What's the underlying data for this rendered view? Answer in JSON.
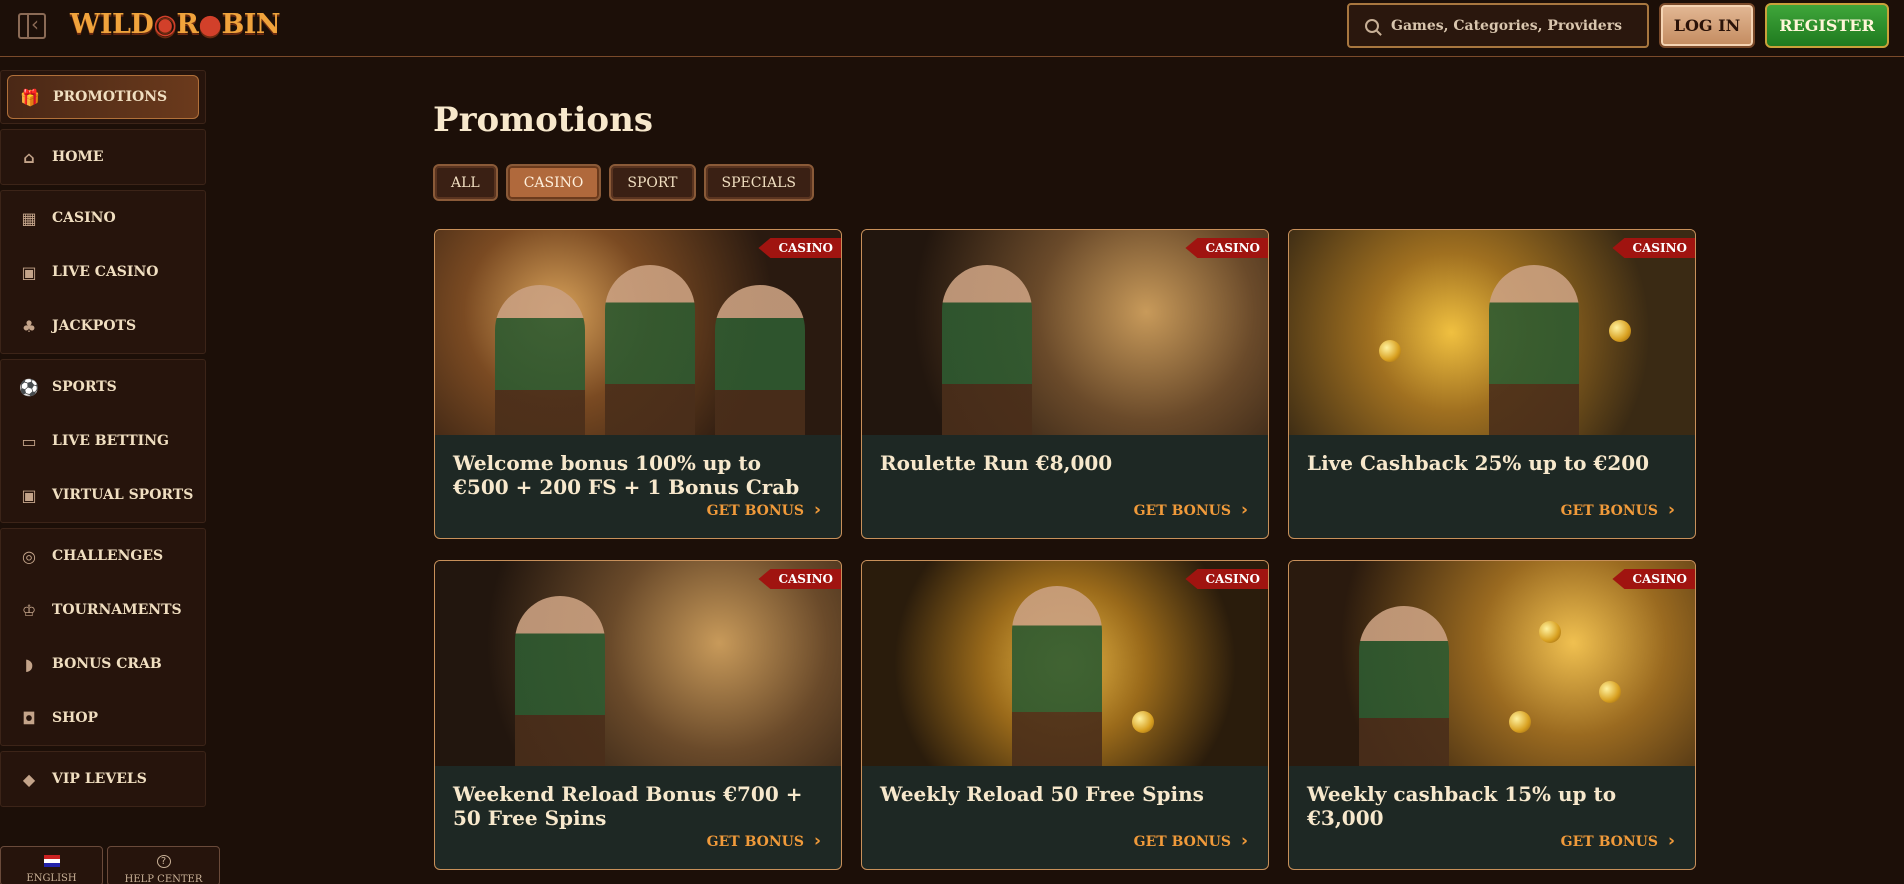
{
  "header": {
    "logo_text_1": "WILD",
    "logo_text_2": "R",
    "logo_text_3": "BIN",
    "search_placeholder": "Games, Categories, Providers",
    "login_label": "LOG IN",
    "register_label": "REGISTER"
  },
  "sidebar": {
    "groups": [
      [
        {
          "label": "PROMOTIONS",
          "icon": "gift-icon",
          "active": true
        }
      ],
      [
        {
          "label": "HOME",
          "icon": "home-icon"
        }
      ],
      [
        {
          "label": "CASINO",
          "icon": "slot-machine-icon"
        },
        {
          "label": "LIVE CASINO",
          "icon": "live-cards-icon"
        },
        {
          "label": "JACKPOTS",
          "icon": "clover-icon"
        }
      ],
      [
        {
          "label": "SPORTS",
          "icon": "football-icon"
        },
        {
          "label": "LIVE BETTING",
          "icon": "live-badge-icon"
        },
        {
          "label": "VIRTUAL SPORTS",
          "icon": "virtual-sports-icon"
        }
      ],
      [
        {
          "label": "CHALLENGES",
          "icon": "target-icon"
        },
        {
          "label": "TOURNAMENTS",
          "icon": "trophy-icon"
        },
        {
          "label": "BONUS CRAB",
          "icon": "crab-icon"
        },
        {
          "label": "SHOP",
          "icon": "shopping-bag-icon"
        }
      ],
      [
        {
          "label": "VIP LEVELS",
          "icon": "diamond-icon"
        }
      ]
    ],
    "language_label": "ENGLISH",
    "help_label": "HELP CENTER"
  },
  "main": {
    "title": "Promotions",
    "filters": [
      {
        "label": "ALL",
        "active": false
      },
      {
        "label": "CASINO",
        "active": true
      },
      {
        "label": "SPORT",
        "active": false
      },
      {
        "label": "SPECIALS",
        "active": false
      }
    ],
    "cards": [
      {
        "badge": "CASINO",
        "title": "Welcome bonus 100% up to €500 + 200 FS + 1 Bonus Crab",
        "cta": "GET BONUS"
      },
      {
        "badge": "CASINO",
        "title": "Roulette Run €8,000",
        "cta": "GET BONUS"
      },
      {
        "badge": "CASINO",
        "title": "Live Cashback 25% up to €200",
        "cta": "GET BONUS"
      },
      {
        "badge": "CASINO",
        "title": "Weekend Reload Bonus €700 + 50 Free Spins",
        "cta": "GET BONUS"
      },
      {
        "badge": "CASINO",
        "title": "Weekly Reload 50 Free Spins",
        "cta": "GET BONUS"
      },
      {
        "badge": "CASINO",
        "title": "Weekly cashback 15% up to €3,000",
        "cta": "GET BONUS"
      }
    ]
  }
}
